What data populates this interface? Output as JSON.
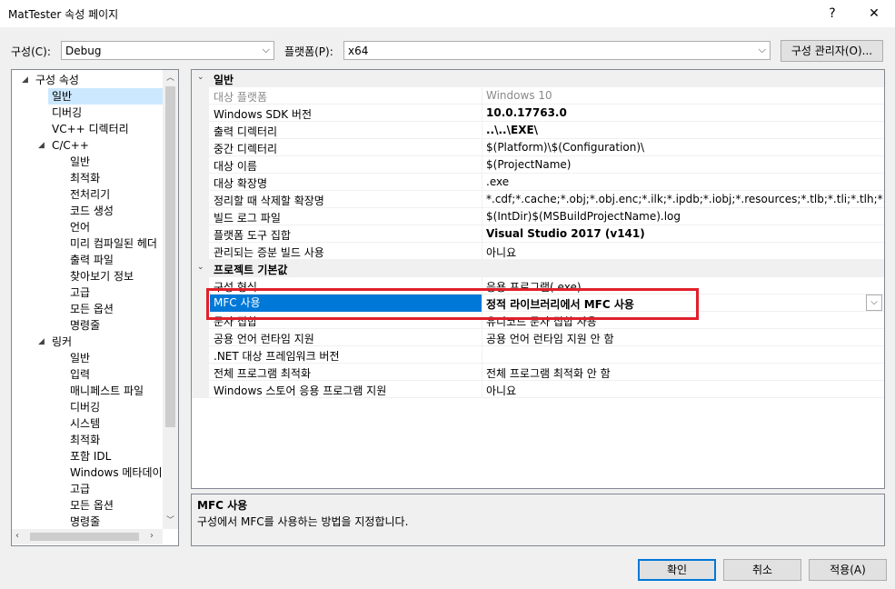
{
  "window": {
    "title": "MatTester 속성 페이지",
    "help": "?",
    "close": "✕"
  },
  "toolbar": {
    "config_label": "구성(C):",
    "config_value": "Debug",
    "platform_label": "플랫폼(P):",
    "platform_value": "x64",
    "config_manager": "구성 관리자(O)..."
  },
  "tree": {
    "items": [
      {
        "label": "구성 속성",
        "level": 0,
        "expander": "◢"
      },
      {
        "label": "일반",
        "level": 1,
        "selected": true
      },
      {
        "label": "디버깅",
        "level": 1
      },
      {
        "label": "VC++ 디렉터리",
        "level": 1
      },
      {
        "label": "C/C++",
        "level": 1,
        "expander": "◢"
      },
      {
        "label": "일반",
        "level": 2
      },
      {
        "label": "최적화",
        "level": 2
      },
      {
        "label": "전처리기",
        "level": 2
      },
      {
        "label": "코드 생성",
        "level": 2
      },
      {
        "label": "언어",
        "level": 2
      },
      {
        "label": "미리 컴파일된 헤더",
        "level": 2
      },
      {
        "label": "출력 파일",
        "level": 2
      },
      {
        "label": "찾아보기 정보",
        "level": 2
      },
      {
        "label": "고급",
        "level": 2
      },
      {
        "label": "모든 옵션",
        "level": 2
      },
      {
        "label": "명령줄",
        "level": 2
      },
      {
        "label": "링커",
        "level": 1,
        "expander": "◢"
      },
      {
        "label": "일반",
        "level": 2
      },
      {
        "label": "입력",
        "level": 2
      },
      {
        "label": "매니페스트 파일",
        "level": 2
      },
      {
        "label": "디버깅",
        "level": 2
      },
      {
        "label": "시스템",
        "level": 2
      },
      {
        "label": "최적화",
        "level": 2
      },
      {
        "label": "포함 IDL",
        "level": 2
      },
      {
        "label": "Windows 메타데이",
        "level": 2
      },
      {
        "label": "고급",
        "level": 2
      },
      {
        "label": "모든 옵션",
        "level": 2
      },
      {
        "label": "명령줄",
        "level": 2
      }
    ]
  },
  "grid": {
    "categories": [
      {
        "label": "일반",
        "expander": "⌄",
        "rows": [
          {
            "name": "대상 플랫폼",
            "value": "Windows 10",
            "style": "gray"
          },
          {
            "name": "Windows SDK 버전",
            "value": "10.0.17763.0",
            "style": "bold"
          },
          {
            "name": "출력 디렉터리",
            "value": "..\\..\\EXE\\",
            "style": "bold"
          },
          {
            "name": "중간 디렉터리",
            "value": "$(Platform)\\$(Configuration)\\",
            "style": ""
          },
          {
            "name": "대상 이름",
            "value": "$(ProjectName)",
            "style": ""
          },
          {
            "name": "대상 확장명",
            "value": ".exe",
            "style": ""
          },
          {
            "name": "정리할 때 삭제할 확장명",
            "value": "*.cdf;*.cache;*.obj;*.obj.enc;*.ilk;*.ipdb;*.iobj;*.resources;*.tlb;*.tli;*.tlh;*.tmp;*.rsp;*.",
            "style": ""
          },
          {
            "name": "빌드 로그 파일",
            "value": "$(IntDir)$(MSBuildProjectName).log",
            "style": ""
          },
          {
            "name": "플랫폼 도구 집합",
            "value": "Visual Studio 2017 (v141)",
            "style": "bold"
          },
          {
            "name": "관리되는 증분 빌드 사용",
            "value": "아니요",
            "style": ""
          }
        ]
      },
      {
        "label": "프로젝트 기본값",
        "expander": "⌄",
        "rows": [
          {
            "name": "구성 형식",
            "value": "응용 프로그램(.exe)",
            "style": ""
          },
          {
            "name": "MFC 사용",
            "value": "정적 라이브러리에서 MFC 사용",
            "style": "bold",
            "selected": true
          },
          {
            "name": "문자 집합",
            "value": "유니코드 문자 집합 사용",
            "style": ""
          },
          {
            "name": "공용 언어 런타임 지원",
            "value": "공용 언어 런타임 지원 안 함",
            "style": ""
          },
          {
            "name": ".NET 대상 프레임워크 버전",
            "value": "",
            "style": ""
          },
          {
            "name": "전체 프로그램 최적화",
            "value": "전체 프로그램 최적화 안 함",
            "style": ""
          },
          {
            "name": "Windows 스토어 응용 프로그램 지원",
            "value": "아니요",
            "style": ""
          }
        ]
      }
    ]
  },
  "description": {
    "title": "MFC 사용",
    "text": "구성에서 MFC를 사용하는 방법을 지정합니다."
  },
  "buttons": {
    "ok": "확인",
    "cancel": "취소",
    "apply": "적용(A)"
  },
  "colors": {
    "highlight_box": "#e0202a",
    "selection": "#0078d7"
  }
}
